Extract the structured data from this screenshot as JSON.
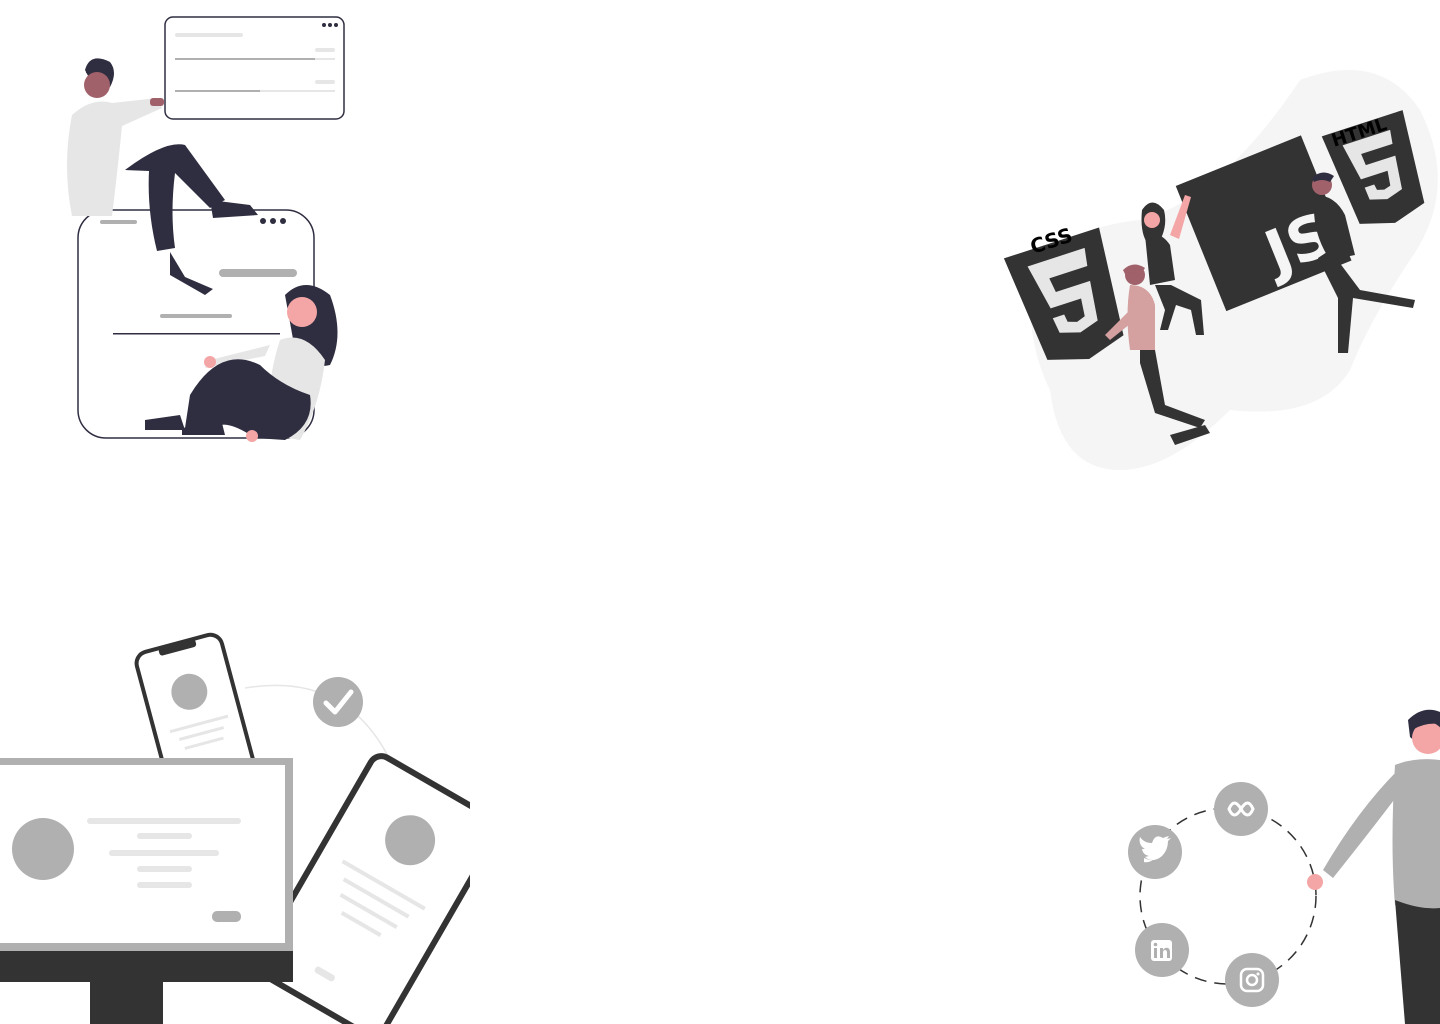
{
  "palette": {
    "dark": "#2f2e41",
    "black": "#333333",
    "gray": "#b0b0b0",
    "light_gray": "#e6e6e6",
    "pale": "#f5f5f5",
    "skin": "#f4a6a6",
    "pink": "#d4a0a0",
    "skin_dark": "#a0616a"
  },
  "illustrations": {
    "top_left": {
      "icon": "people-with-ui-cards"
    },
    "top_right": {
      "icon": "web-technologies",
      "css_label": "CSS",
      "js_label": "JS",
      "html_label": "HTML"
    },
    "bottom_left": {
      "icon": "responsive-devices",
      "check_icon": "check-icon"
    },
    "bottom_right": {
      "icon": "social-network",
      "social_icons": [
        "meta-icon",
        "twitter-icon",
        "linkedin-icon",
        "instagram-icon"
      ]
    }
  }
}
